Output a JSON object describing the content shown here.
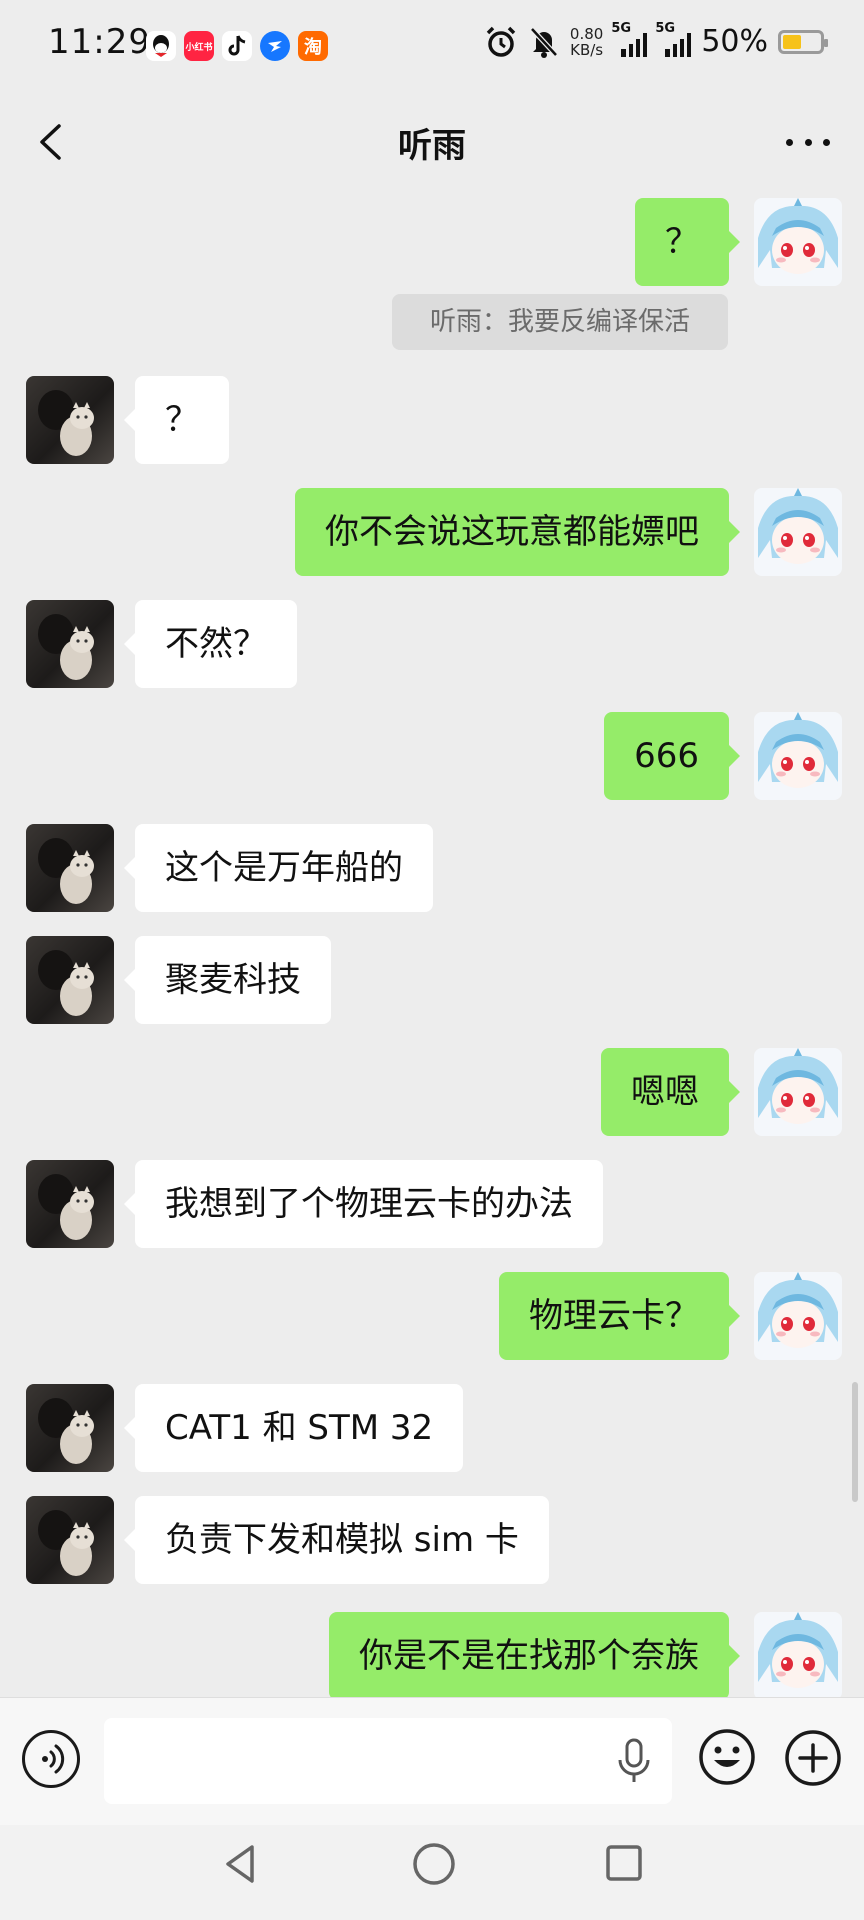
{
  "status_bar": {
    "time": "11:29",
    "network_speed": "0.80",
    "network_speed_unit": "KB/s",
    "signal_1": "5G",
    "signal_2": "5G",
    "battery": "50%",
    "battery_level": 0.5,
    "app_icons": [
      "qq-icon",
      "xiaohongshu-icon",
      "douyin-icon",
      "dingtalk-icon",
      "taobao-icon"
    ],
    "taobao_glyph": "淘",
    "xhs_glyph": "小红书"
  },
  "header": {
    "title": "听雨"
  },
  "system_notice": "听雨：我要反编译保活",
  "messages": [
    {
      "side": "right",
      "text": "？"
    },
    {
      "side": "left",
      "text": "？"
    },
    {
      "side": "right",
      "text": "你不会说这玩意都能嫖吧"
    },
    {
      "side": "left",
      "text": "不然？"
    },
    {
      "side": "right",
      "text": "666"
    },
    {
      "side": "left",
      "text": "这个是万年船的"
    },
    {
      "side": "left",
      "text": "聚麦科技"
    },
    {
      "side": "right",
      "text": "嗯嗯"
    },
    {
      "side": "left",
      "text": "我想到了个物理云卡的办法"
    },
    {
      "side": "right",
      "text": "物理云卡？"
    },
    {
      "side": "left",
      "text": "CAT1 和 STM 32"
    },
    {
      "side": "left",
      "text": "负责下发和模拟 sim 卡"
    },
    {
      "side": "right",
      "text": "你是不是在找那个奈族"
    }
  ],
  "input_bar": {
    "value": "",
    "placeholder": ""
  },
  "colors": {
    "background": "#ededed",
    "outgoing_bubble": "#95ec69",
    "incoming_bubble": "#ffffff",
    "battery_fill": "#f6c21a"
  }
}
